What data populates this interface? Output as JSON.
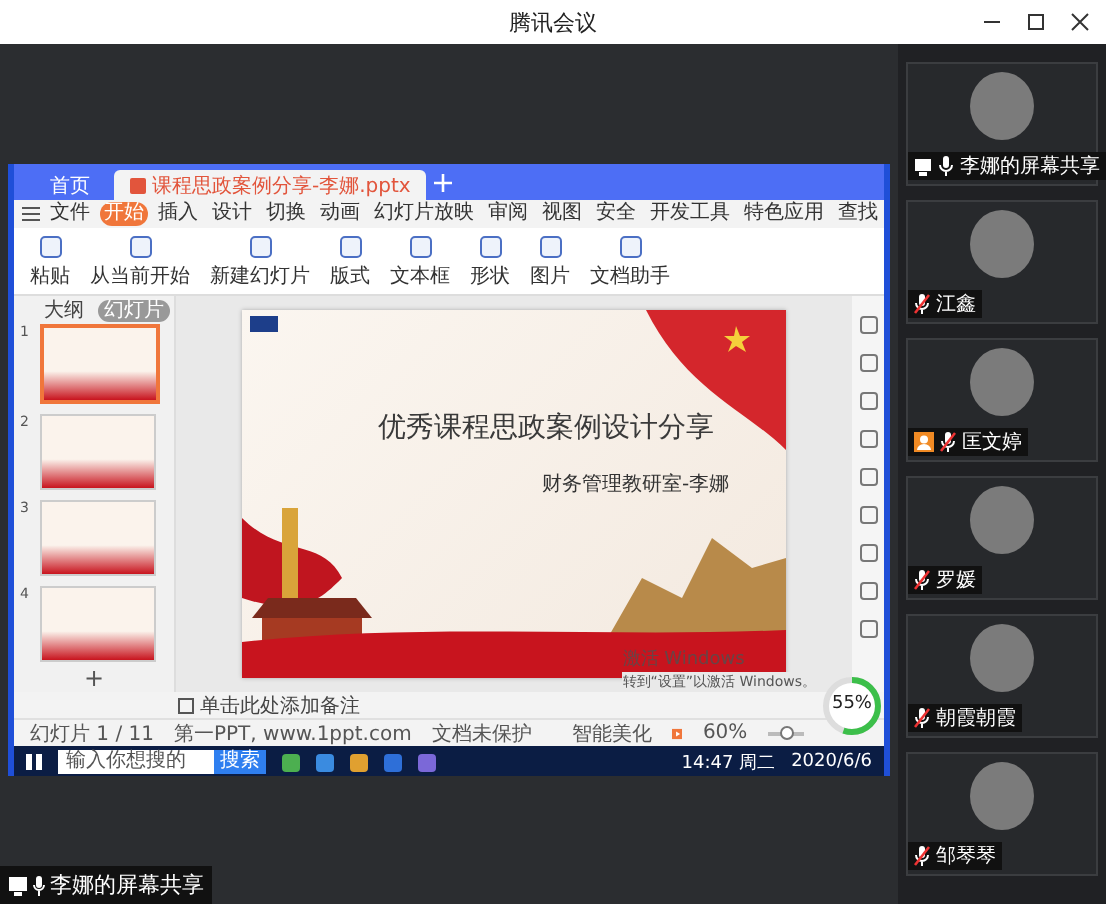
{
  "window": {
    "title": "腾讯会议"
  },
  "shared_screen": {
    "tabs": [
      {
        "label": "首页",
        "selected": false
      },
      {
        "label": "课程思政案例分享-李娜.pptx",
        "selected": true
      }
    ],
    "menu": [
      {
        "label": "文件",
        "selected": false
      },
      {
        "label": "开始",
        "selected": true
      },
      {
        "label": "插入",
        "selected": false
      },
      {
        "label": "设计",
        "selected": false
      },
      {
        "label": "切换",
        "selected": false
      },
      {
        "label": "动画",
        "selected": false
      },
      {
        "label": "幻灯片放映",
        "selected": false
      },
      {
        "label": "审阅",
        "selected": false
      },
      {
        "label": "视图",
        "selected": false
      },
      {
        "label": "安全",
        "selected": false
      },
      {
        "label": "开发工具",
        "selected": false
      },
      {
        "label": "特色应用",
        "selected": false
      },
      {
        "label": "查找",
        "selected": false
      }
    ],
    "ribbon": [
      {
        "label": "粘贴"
      },
      {
        "label": "从当前开始"
      },
      {
        "label": "新建幻灯片"
      },
      {
        "label": "版式"
      },
      {
        "label": "文本框"
      },
      {
        "label": "形状"
      },
      {
        "label": "图片"
      },
      {
        "label": "文档助手"
      }
    ],
    "pane_tabs": [
      {
        "label": "大纲",
        "selected": false
      },
      {
        "label": "幻灯片",
        "selected": true
      }
    ],
    "thumbnails": [
      {
        "number": "1",
        "selected": true
      },
      {
        "number": "2",
        "selected": false
      },
      {
        "number": "3",
        "selected": false
      },
      {
        "number": "4",
        "selected": false
      }
    ],
    "add_slide": "+",
    "slide": {
      "title": "优秀课程思政案例设计分享",
      "subtitle": "财务管理教研室-李娜"
    },
    "notes_placeholder": "单击此处添加备注",
    "status": {
      "slide_count": "幻灯片 1 / 11",
      "theme": "第一PPT, www.1ppt.com",
      "protection": "文档未保护",
      "beautify": "智能美化",
      "zoom": "60%",
      "level": 0.5
    },
    "activation": {
      "title": "激活 Windows",
      "hint": "转到“设置”以激活 Windows。"
    },
    "meter": {
      "reading": "55%",
      "level": 0.55
    },
    "taskbar": {
      "search_placeholder": "输入你想搜的",
      "search_button": "搜索",
      "time": "14:47 周二",
      "date": "2020/6/6"
    }
  },
  "participants": [
    {
      "name": "李娜的屏幕共享",
      "kind": "screen_share",
      "muted": false,
      "host": false
    },
    {
      "name": "江鑫",
      "kind": "camera_off",
      "muted": true,
      "host": false
    },
    {
      "name": "匡文婷",
      "kind": "camera_off",
      "muted": true,
      "host": true
    },
    {
      "name": "罗媛",
      "kind": "camera_off",
      "muted": true,
      "host": false
    },
    {
      "name": "朝霞朝霞",
      "kind": "camera_off",
      "muted": true,
      "host": false
    },
    {
      "name": "邹琴琴",
      "kind": "camera_off",
      "muted": true,
      "host": false
    }
  ],
  "share_label": "李娜的屏幕共享"
}
